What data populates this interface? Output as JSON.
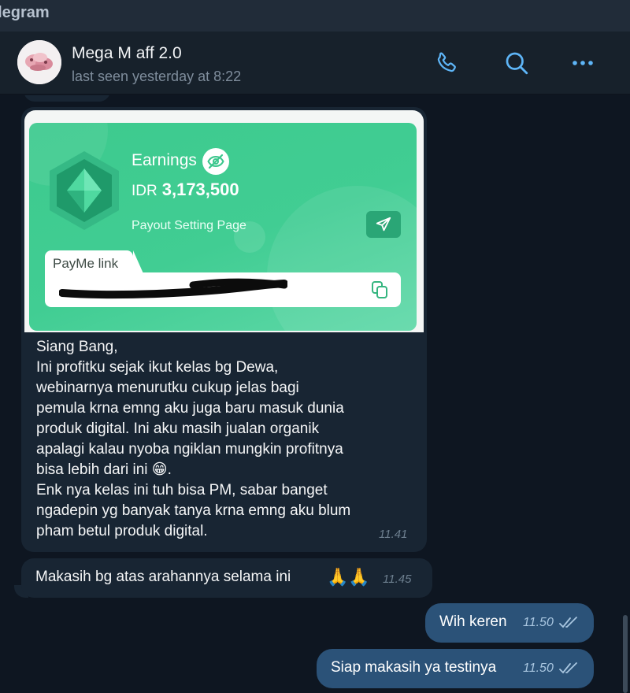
{
  "window": {
    "title": "elegram"
  },
  "header": {
    "chat_name": "Mega M aff 2.0",
    "status": "last seen yesterday at 8:22",
    "icons": [
      "phone-icon",
      "search-icon",
      "more-icon"
    ],
    "accent": "#5eb5f7"
  },
  "messages": {
    "photo_message": {
      "card": {
        "earnings_label": "Earnings",
        "currency": "IDR",
        "amount": "3,173,500",
        "payout_label": "Payout Setting Page",
        "payme_label": "PayMe link"
      },
      "text": "Siang Bang,\nIni profitku sejak ikut kelas bg Dewa,\nwebinarnya menurutku cukup jelas bagi\npemula krna emng aku juga baru masuk dunia\nproduk digital. Ini aku masih jualan organik\napalagi kalau nyoba ngiklan mungkin profitnya\nbisa lebih dari ini 😁.\nEnk nya kelas ini tuh bisa PM, sabar banget\nngadepin yg banyak tanya krna emng aku blum\npham betul produk digital.",
      "time": "11.41"
    },
    "incoming_2": {
      "text": "Makasih bg atas arahannya selama ini",
      "emoji": "🙏🙏",
      "time": "11.45"
    },
    "outgoing_1": {
      "text": "Wih keren",
      "time": "11.50"
    },
    "outgoing_2": {
      "text": "Siap makasih ya testinya",
      "time": "11.50"
    }
  },
  "colors": {
    "background": "#0e1621",
    "incoming_bubble": "#182533",
    "outgoing_bubble": "#2b5278",
    "card_green": "#41cd93"
  }
}
